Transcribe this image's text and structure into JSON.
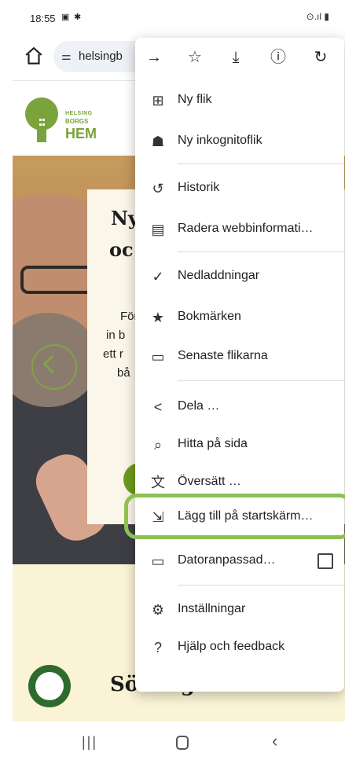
{
  "status": {
    "time": "18:55",
    "signal_text": "⊙.ıl"
  },
  "address_bar": {
    "url": "helsingb"
  },
  "site": {
    "logo_line1": "HELSING",
    "logo_line2": "BORGS",
    "logo_line3": "HEM",
    "hero_title_line1": "Ny",
    "hero_title_line2": "oc",
    "hero_para": [
      "För",
      "in b",
      "ett r",
      "bå"
    ],
    "search_heading": "Sök lägenhet"
  },
  "menu": {
    "toolbar": {
      "forward": "→",
      "bookmark": "☆",
      "download": "⤓",
      "info": "ⓘ",
      "reload": "↻"
    },
    "items": [
      {
        "label": "Ny flik"
      },
      {
        "label": "Ny inkognitoflik"
      },
      {
        "label": "Historik"
      },
      {
        "label": "Radera webbinformati…"
      },
      {
        "label": "Nedladdningar"
      },
      {
        "label": "Bokmärken"
      },
      {
        "label": "Senaste flikarna"
      },
      {
        "label": "Dela …"
      },
      {
        "label": "Hitta på sida"
      },
      {
        "label": "Översätt …"
      },
      {
        "label": "Lägg till på startskärm…"
      },
      {
        "label": "Datoranpassad…"
      },
      {
        "label": "Inställningar"
      },
      {
        "label": "Hjälp och feedback"
      }
    ],
    "highlight_color": "#8cc152"
  }
}
